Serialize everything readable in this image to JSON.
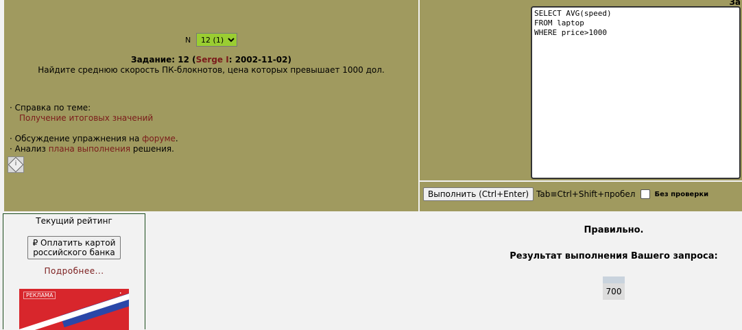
{
  "task": {
    "selector_label": "N",
    "selector_value": "12 (1)",
    "title_prefix": "Задание: 12 (",
    "author": "Serge I",
    "title_suffix": ": 2002-11-02)",
    "text": "Найдите среднюю скорость ПК-блокнотов, цена которых превышает 1000 дол."
  },
  "links": {
    "help_label": "· Справка по теме:",
    "help_link": "Получение итоговых значений",
    "forum_prefix": "· Обсуждение упражнения на ",
    "forum_link": "форуме",
    "forum_suffix": ".",
    "plan_prefix": "· Анализ ",
    "plan_link": "плана выполнения",
    "plan_suffix": " решения."
  },
  "editor": {
    "header_stub": "За",
    "sql": "SELECT AVG(speed)\nFROM laptop\nWHERE price>1000"
  },
  "run": {
    "button_label": "Выполнить (Ctrl+Enter)",
    "hint": "Tab≡Ctrl+Shift+пробел",
    "nocheck_label": "Без проверки"
  },
  "rating": {
    "title": "Текущий рейтинг",
    "pay_button": "₽ Оплатить картой российского банка",
    "more_link": "Подробнее...",
    "ad_label": "РЕКЛАМА"
  },
  "result": {
    "status": "Правильно.",
    "heading": "Результат выполнения Вашего запроса:",
    "column_header": "",
    "rows": [
      "700"
    ]
  },
  "colors": {
    "panel": "#a09a5f",
    "link": "#7a1a1a",
    "select_bg": "#9acd32"
  }
}
